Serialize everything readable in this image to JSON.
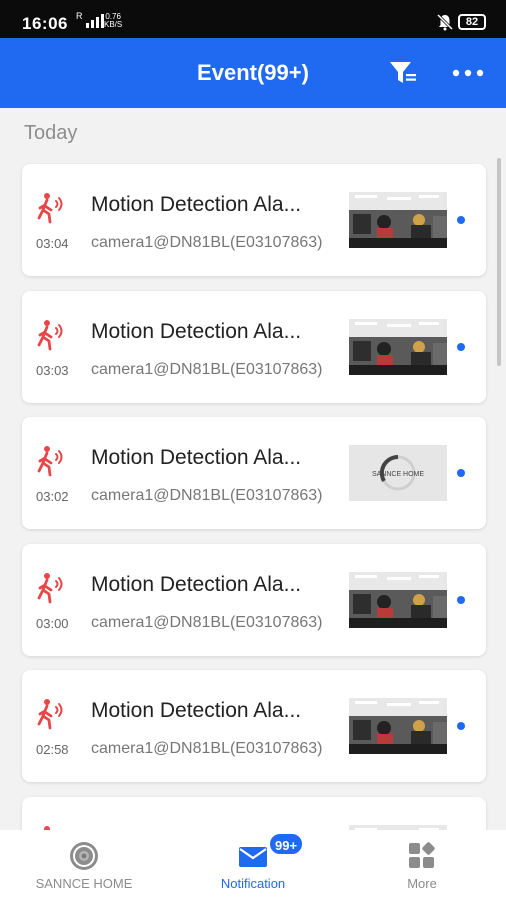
{
  "status_bar": {
    "time": "16:06",
    "network_speed_value": "0.76",
    "network_speed_unit": "KB/S",
    "battery": "82",
    "icons": [
      "signal-icon",
      "mute-icon",
      "battery-icon"
    ]
  },
  "header": {
    "title": "Event(99+)",
    "icons": [
      "filter-icon",
      "more-icon"
    ],
    "color": "#1f6af0"
  },
  "section_label": "Today",
  "events": [
    {
      "time": "03:04",
      "title": "Motion Detection Ala...",
      "subtitle": "camera1@DN81BL(E03107863)",
      "thumb": "camera-snapshot",
      "unread": true
    },
    {
      "time": "03:03",
      "title": "Motion Detection Ala...",
      "subtitle": "camera1@DN81BL(E03107863)",
      "thumb": "camera-snapshot",
      "unread": true
    },
    {
      "time": "03:02",
      "title": "Motion Detection Ala...",
      "subtitle": "camera1@DN81BL(E03107863)",
      "thumb": "sannce-loading",
      "thumb_text": "SANNCE HOME",
      "unread": true
    },
    {
      "time": "03:00",
      "title": "Motion Detection Ala...",
      "subtitle": "camera1@DN81BL(E03107863)",
      "thumb": "camera-snapshot",
      "unread": true
    },
    {
      "time": "02:58",
      "title": "Motion Detection Ala...",
      "subtitle": "camera1@DN81BL(E03107863)",
      "thumb": "camera-snapshot",
      "unread": true
    },
    {
      "time": "",
      "title": "",
      "subtitle": "",
      "thumb": "camera-snapshot",
      "unread": false
    }
  ],
  "tabs": [
    {
      "label": "SANNCE HOME",
      "icon": "camera-lens-icon",
      "active": false
    },
    {
      "label": "Notification",
      "icon": "mail-icon",
      "active": true,
      "badge": "99+"
    },
    {
      "label": "More",
      "icon": "grid-icon",
      "active": false
    }
  ],
  "colors": {
    "accent": "#1f6af0",
    "alarm": "#e8474a",
    "background": "#f2f2f2"
  }
}
